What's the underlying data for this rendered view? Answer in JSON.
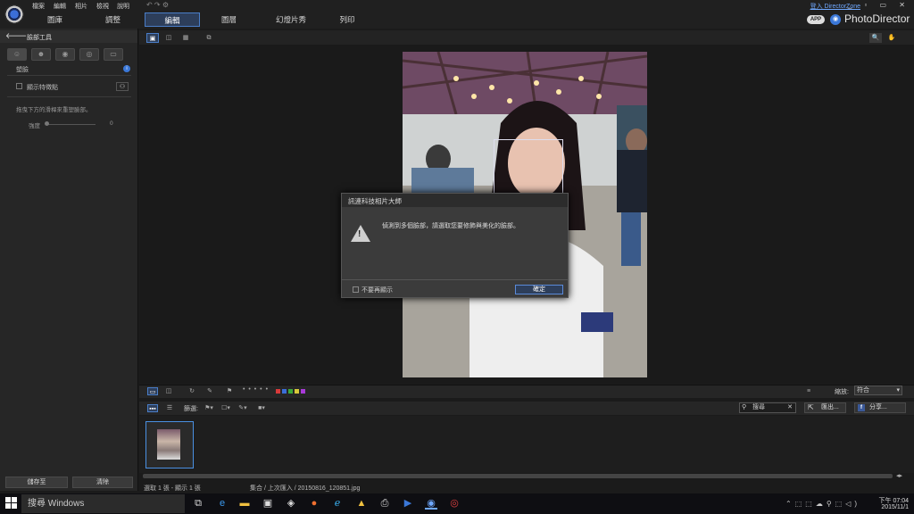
{
  "menu": [
    "檔案",
    "編輯",
    "相片",
    "檢視",
    "說明"
  ],
  "top_tabs": [
    "圖庫",
    "調整",
    "編輯",
    "圖層",
    "幻燈片秀",
    "列印"
  ],
  "directorzone_link": "登入 DirectorZone",
  "app_badge": "APP",
  "app_name": "PhotoDirector",
  "left_panel": {
    "title": "臉部工具",
    "section": "塑臉",
    "show_points_label": "顯示特徵點",
    "hint": "拖曳下方的滑桿來重塑臉部。",
    "strength_label": "強度",
    "strength_value": "0",
    "save_button": "儲存至",
    "clear_button": "清除"
  },
  "dialog": {
    "title": "訊連科技相片大師",
    "message": "偵測到多個臉部，請選取您要修飾與美化的臉部。",
    "dont_show_label": "不要再顯示",
    "ok_button": "確定"
  },
  "bottom_toolbar": {
    "zoom_label": "縮放:",
    "zoom_value": "符合",
    "filter_label": "篩選:",
    "search_placeholder": "搜尋",
    "export_button": "匯出...",
    "share_button": "分享...",
    "color_labels": [
      "#d83a3a",
      "#3a6ed8",
      "#3aa83a",
      "#d8c83a",
      "#a83ad8"
    ]
  },
  "status": {
    "selection": "選取 1 張 - 顯示 1 張",
    "path": "集合 / 上次匯入 / 20150816_120851.jpg"
  },
  "taskbar": {
    "search": "搜尋 Windows",
    "time": "下午 07:04",
    "date": "2015/11/1"
  }
}
